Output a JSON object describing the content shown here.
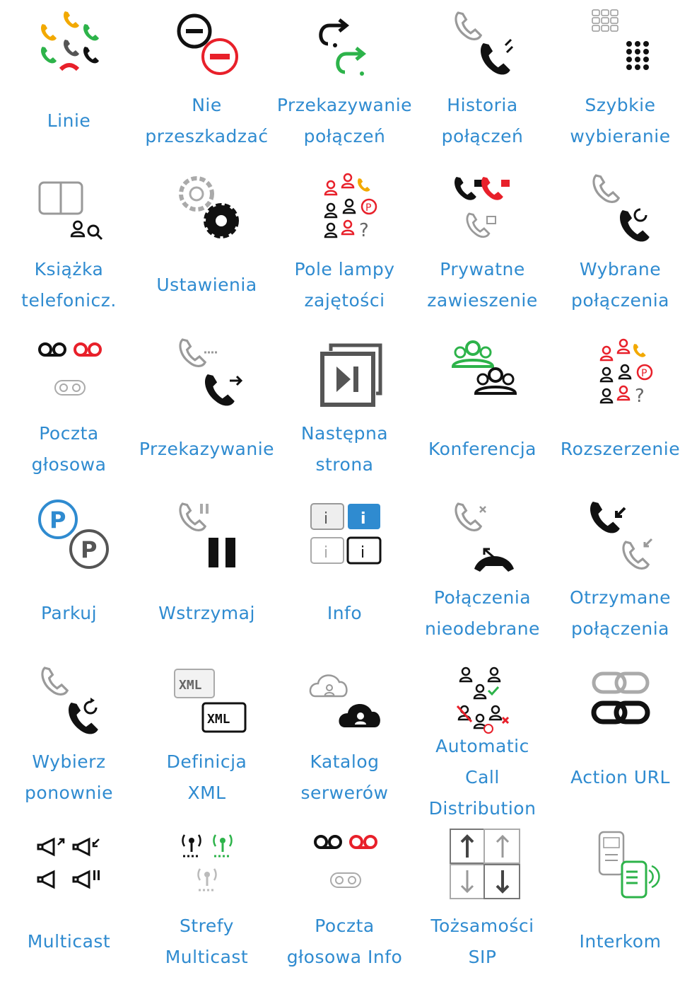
{
  "tiles": [
    {
      "icon": "lines-icon",
      "label": [
        "Linie"
      ]
    },
    {
      "icon": "do-not-disturb-icon",
      "label": [
        "Nie",
        "przeszkadzać"
      ]
    },
    {
      "icon": "call-forward-icon",
      "label": [
        "Przekazywanie",
        "połączeń"
      ]
    },
    {
      "icon": "call-history-icon",
      "label": [
        "Historia",
        "połączeń"
      ]
    },
    {
      "icon": "speed-dial-icon",
      "label": [
        "Szybkie",
        "wybieranie"
      ]
    },
    {
      "icon": "phonebook-icon",
      "label": [
        "Książka",
        "telefonicz."
      ]
    },
    {
      "icon": "settings-icon",
      "label": [
        "Ustawienia"
      ]
    },
    {
      "icon": "busy-lamp-field-icon",
      "label": [
        "Pole lampy",
        "zajętości"
      ]
    },
    {
      "icon": "private-hold-icon",
      "label": [
        "Prywatne",
        "zawieszenie"
      ]
    },
    {
      "icon": "dialed-calls-icon",
      "label": [
        "Wybrane",
        "połączenia"
      ]
    },
    {
      "icon": "voicemail-icon",
      "label": [
        "Poczta",
        "głosowa"
      ]
    },
    {
      "icon": "transfer-icon",
      "label": [
        "Przekazywanie"
      ]
    },
    {
      "icon": "next-page-icon",
      "label": [
        "Następna",
        "strona"
      ]
    },
    {
      "icon": "conference-icon",
      "label": [
        "Konferencja"
      ]
    },
    {
      "icon": "extension-icon",
      "label": [
        "Rozszerzenie"
      ]
    },
    {
      "icon": "park-icon",
      "label": [
        "Parkuj"
      ]
    },
    {
      "icon": "hold-icon",
      "label": [
        "Wstrzymaj"
      ]
    },
    {
      "icon": "info-icon",
      "label": [
        "Info"
      ]
    },
    {
      "icon": "missed-calls-icon",
      "label": [
        "Połączenia",
        "nieodebrane"
      ]
    },
    {
      "icon": "received-calls-icon",
      "label": [
        "Otrzymane",
        "połączenia"
      ]
    },
    {
      "icon": "redial-icon",
      "label": [
        "Wybierz",
        "ponownie"
      ]
    },
    {
      "icon": "xml-definition-icon",
      "label": [
        "Definicja",
        "XML"
      ]
    },
    {
      "icon": "server-directory-icon",
      "label": [
        "Katalog",
        "serwerów"
      ]
    },
    {
      "icon": "acd-icon",
      "label": [
        "Automatic",
        "Call",
        "Distribution"
      ]
    },
    {
      "icon": "action-url-icon",
      "label": [
        "Action URL"
      ]
    },
    {
      "icon": "multicast-icon",
      "label": [
        "Multicast"
      ]
    },
    {
      "icon": "multicast-zones-icon",
      "label": [
        "Strefy",
        "Multicast"
      ]
    },
    {
      "icon": "voicemail-info-icon",
      "label": [
        "Poczta",
        "głosowa Info"
      ]
    },
    {
      "icon": "sip-identities-icon",
      "label": [
        "Tożsamości",
        "SIP"
      ]
    },
    {
      "icon": "intercom-icon",
      "label": [
        "Interkom"
      ]
    }
  ],
  "colors": {
    "label": "#2f8bd0",
    "red": "#e8202a",
    "green": "#2db34a",
    "yellow": "#f2a900",
    "grey": "#8a8a8a",
    "black": "#111111"
  }
}
